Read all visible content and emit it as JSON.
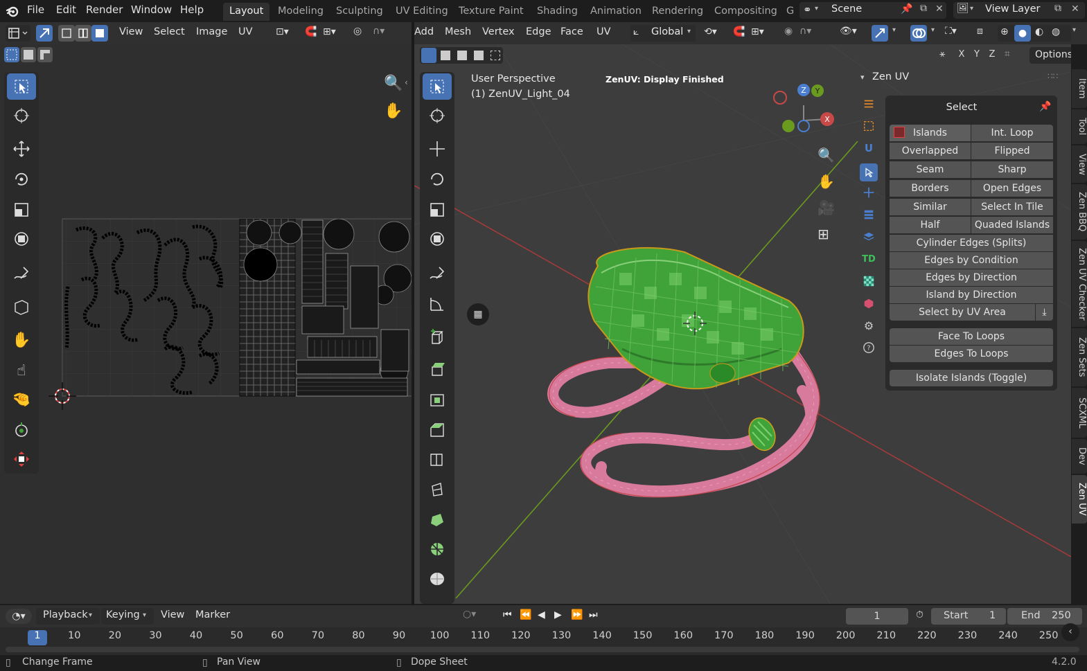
{
  "topbar": {
    "menus": [
      "File",
      "Edit",
      "Render",
      "Window",
      "Help"
    ],
    "workspaces": [
      "Layout",
      "Modeling",
      "Sculpting",
      "UV Editing",
      "Texture Paint",
      "Shading",
      "Animation",
      "Rendering",
      "Compositing",
      "G"
    ],
    "active_workspace": "Layout",
    "scene": "Scene",
    "view_layer": "View Layer"
  },
  "uv_editor": {
    "menus": [
      "View",
      "Select",
      "Image",
      "UV"
    ]
  },
  "viewport": {
    "menus": [
      "Add",
      "Mesh",
      "Vertex",
      "Edge",
      "Face",
      "UV"
    ],
    "transform_orientation": "Global",
    "options_label": "Options",
    "axes": [
      "X",
      "Y",
      "Z"
    ],
    "perspective_label": "User Perspective",
    "object_label": "(1) ZenUV_Light_04",
    "status_message": "ZenUV: Display Finished",
    "gizmo_labels": {
      "x": "X",
      "y": "Y",
      "z": "Z"
    }
  },
  "zen_panel": {
    "title": "Zen UV",
    "section": "Select",
    "grid_rows": [
      [
        "Islands",
        "Int. Loop"
      ],
      [
        "Overlapped",
        "Flipped"
      ],
      [
        "Seam",
        "Sharp"
      ],
      [
        "Borders",
        "Open Edges"
      ],
      [
        "Similar",
        "Select In Tile"
      ],
      [
        "Half",
        "Quaded Islands"
      ]
    ],
    "full_rows": [
      "Cylinder Edges (Splits)",
      "Edges by Condition",
      "Edges by Direction",
      "Island by Direction",
      "Select by UV Area"
    ],
    "loops": [
      "Face To Loops",
      "Edges To Loops"
    ],
    "isolate": "Isolate Islands (Toggle)",
    "td_label": "TD",
    "u_label": "U"
  },
  "side_tabs": [
    "Item",
    "Tool",
    "View",
    "Zen BBQ",
    "Zen UV Checker",
    "Zen Sets",
    "SCXML",
    "Dev",
    "Zen UV"
  ],
  "active_side_tab": "Zen UV",
  "timeline": {
    "menus": [
      "Playback",
      "Keying",
      "View",
      "Marker"
    ],
    "current_frame": "1",
    "start_label": "Start",
    "start_value": "1",
    "end_label": "End",
    "end_value": "250",
    "ruler": [
      "1",
      "10",
      "20",
      "30",
      "40",
      "50",
      "60",
      "70",
      "80",
      "90",
      "100",
      "110",
      "120",
      "130",
      "140",
      "150",
      "160",
      "170",
      "180",
      "190",
      "200",
      "210",
      "220",
      "230",
      "240",
      "250"
    ]
  },
  "statusbar": {
    "hints": [
      "Change Frame",
      "Pan View",
      "Dope Sheet"
    ],
    "version": "4.2.0"
  },
  "colors": {
    "accent": "#4772b3",
    "mesh_green": "#3fa33a",
    "mesh_pink": "#d87a9c",
    "axis_red": "#c94848",
    "axis_green": "#6a9a1e"
  }
}
